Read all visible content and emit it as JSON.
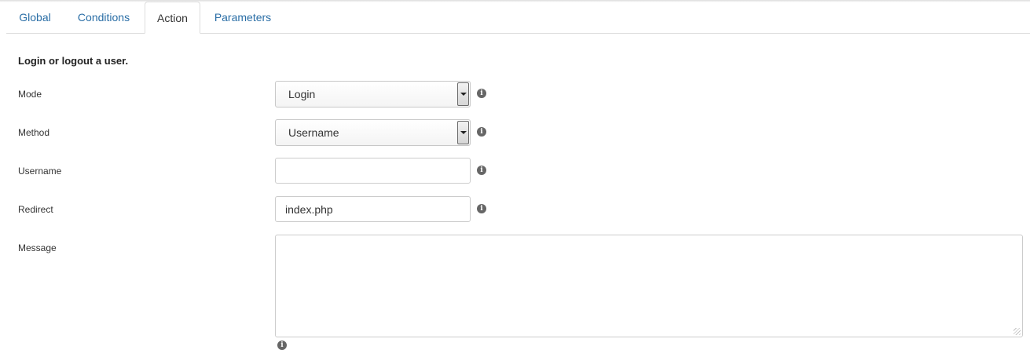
{
  "tabs": [
    {
      "label": "Global"
    },
    {
      "label": "Conditions"
    },
    {
      "label": "Action"
    },
    {
      "label": "Parameters"
    }
  ],
  "active_tab": "Action",
  "form": {
    "heading": "Login or logout a user.",
    "mode": {
      "label": "Mode",
      "value": "Login"
    },
    "method": {
      "label": "Method",
      "value": "Username"
    },
    "username": {
      "label": "Username",
      "value": ""
    },
    "redirect": {
      "label": "Redirect",
      "value": "index.php"
    },
    "message": {
      "label": "Message",
      "value": ""
    }
  },
  "icons": {
    "info": "info-icon",
    "dropdown": "chevron-down-icon",
    "resize": "resize-grip-icon"
  },
  "colors": {
    "link": "#2a6ea6",
    "text": "#333333",
    "border": "#cccccc",
    "info_icon": "#666666"
  }
}
